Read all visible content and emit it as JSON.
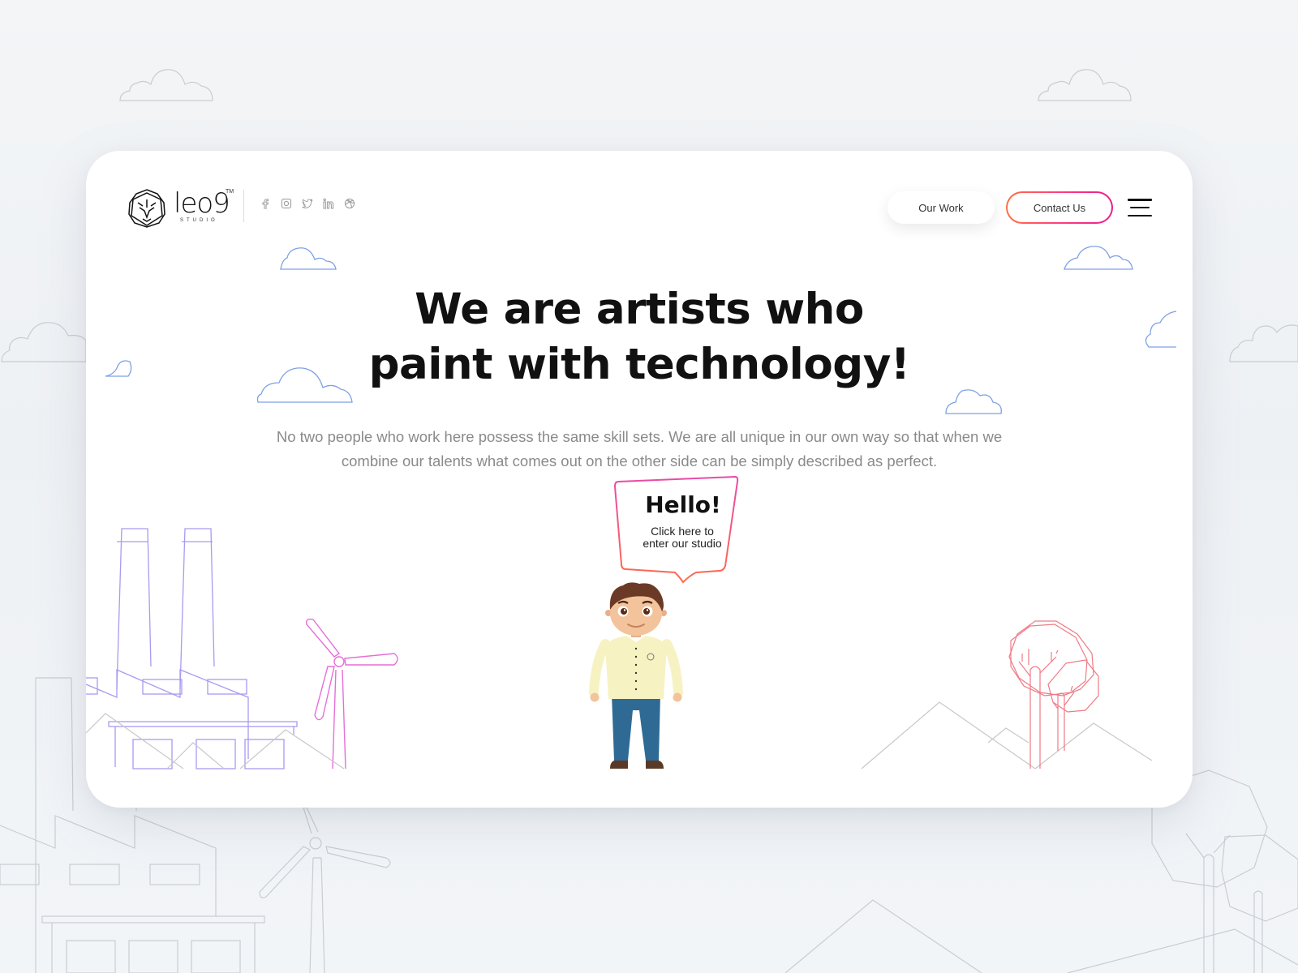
{
  "brand": {
    "name": "leo9",
    "tagline": "STUDIO",
    "trademark": "TM",
    "logo_icon": "lion-head-icon"
  },
  "socials": [
    {
      "name": "facebook",
      "icon": "facebook-icon",
      "glyph": "f"
    },
    {
      "name": "instagram",
      "icon": "instagram-icon",
      "glyph": "◻"
    },
    {
      "name": "twitter",
      "icon": "twitter-icon",
      "glyph": "🐦"
    },
    {
      "name": "linkedin",
      "icon": "linkedin-icon",
      "glyph": "in"
    },
    {
      "name": "dribbble",
      "icon": "dribbble-icon",
      "glyph": "◍"
    }
  ],
  "nav": {
    "our_work_label": "Our Work",
    "contact_label": "Contact Us",
    "menu_icon": "hamburger-menu-icon"
  },
  "hero": {
    "headline_line1": "We are artists who",
    "headline_line2": "paint with technology!",
    "subtext_line1": "No two people who work here possess the same skill sets. We are all unique in our own way so that when we",
    "subtext_line2": "combine our talents what comes out on the other side can be simply described as perfect."
  },
  "speech_bubble": {
    "title": "Hello!",
    "cta_line1": "Click here to",
    "cta_line2": "enter our studio"
  },
  "colors": {
    "accent_gradient_start": "#ff7043",
    "accent_gradient_end": "#e91e8c",
    "factory_line": "#a79bf0",
    "windmill_line": "#e56fd8",
    "tree_line": "#ef7a86",
    "cloud_line": "#7ea1e6",
    "mountain_line": "#c8c8c8",
    "shirt": "#f7f2c2",
    "pants": "#2f6a94"
  }
}
